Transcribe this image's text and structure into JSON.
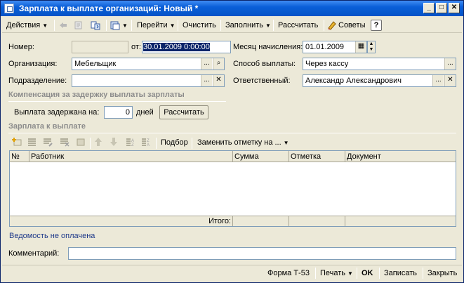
{
  "window": {
    "title": "Зарплата к выплате организаций: Новый *",
    "minimize": "_",
    "maximize": "□",
    "close": "✕"
  },
  "toolbar": {
    "actions_label": "Действия",
    "goto_label": "Перейти",
    "clear_label": "Очистить",
    "fill_label": "Заполнить",
    "calculate_label": "Рассчитать",
    "tips_label": "Советы",
    "help_label": "?"
  },
  "form": {
    "number_label": "Номер:",
    "number_value": "",
    "from_label": "от:",
    "date_value": "30.01.2009  0:00:00",
    "accrual_month_label": "Месяц начисления:",
    "accrual_month_value": "01.01.2009",
    "organization_label": "Организация:",
    "organization_value": "Мебельщик",
    "payment_method_label": "Способ выплаты:",
    "payment_method_value": "Через кассу",
    "department_label": "Подразделение:",
    "department_value": "",
    "responsible_label": "Ответственный:",
    "responsible_value": "Александр Александрович"
  },
  "compensation": {
    "section_title": "Компенсация за задержку выплаты зарплаты",
    "delay_label": "Выплата задержана на:",
    "delay_value": "0",
    "days_label": "дней",
    "calc_button": "Рассчитать"
  },
  "payout": {
    "section_title": "Зарплата к выплате",
    "selection_button": "Подбор",
    "replace_mark_button": "Заменить отметку на ...",
    "columns": [
      "№",
      "Работник",
      "Сумма",
      "Отметка",
      "Документ"
    ],
    "total_label": "Итого:"
  },
  "status_text": "Ведомость не оплачена",
  "comment": {
    "label": "Комментарий:",
    "value": ""
  },
  "bottom": {
    "form_t53": "Форма Т-53",
    "print_label": "Печать",
    "ok_label": "OK",
    "save_label": "Записать",
    "close_label": "Закрыть"
  }
}
